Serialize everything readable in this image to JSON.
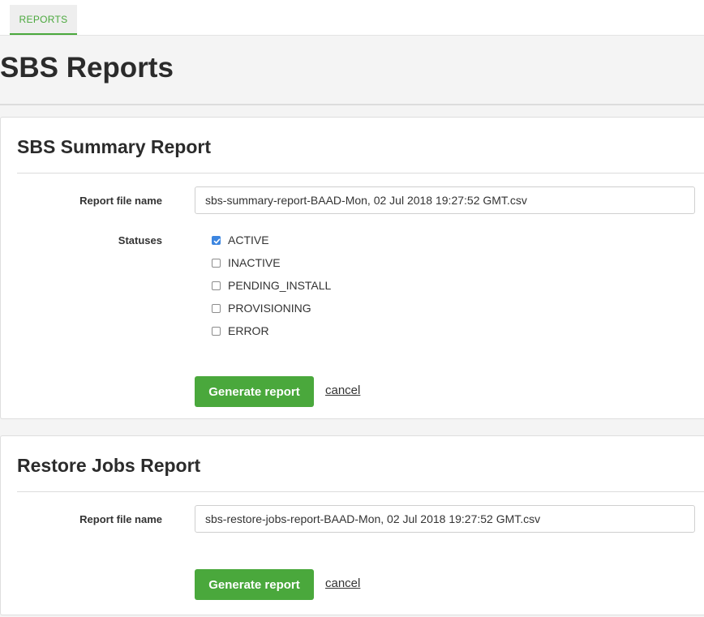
{
  "nav": {
    "tab_reports": "REPORTS"
  },
  "page": {
    "title": "SBS Reports"
  },
  "summary": {
    "title": "SBS Summary Report",
    "file_label": "Report file name",
    "file_value": "sbs-summary-report-BAAD-Mon, 02 Jul 2018 19:27:52 GMT.csv",
    "statuses_label": "Statuses",
    "statuses": [
      {
        "label": "ACTIVE",
        "checked": true
      },
      {
        "label": "INACTIVE",
        "checked": false
      },
      {
        "label": "PENDING_INSTALL",
        "checked": false
      },
      {
        "label": "PROVISIONING",
        "checked": false
      },
      {
        "label": "ERROR",
        "checked": false
      }
    ],
    "generate_label": "Generate report",
    "cancel_label": "cancel"
  },
  "restore": {
    "title": "Restore Jobs Report",
    "file_label": "Report file name",
    "file_value": "sbs-restore-jobs-report-BAAD-Mon, 02 Jul 2018 19:27:52 GMT.csv",
    "generate_label": "Generate report",
    "cancel_label": "cancel"
  },
  "colors": {
    "accent": "#4aa83c",
    "checkbox": "#3d86e0"
  },
  "icons": {
    "checkbox_checked": "check-icon"
  }
}
